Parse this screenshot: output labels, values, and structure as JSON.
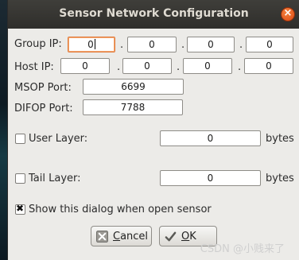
{
  "dialog": {
    "title": "Sensor Network Configuration"
  },
  "group_ip": {
    "label": "Group IP:",
    "octets": [
      "0",
      "0",
      "0",
      "0"
    ],
    "separator": "."
  },
  "host_ip": {
    "label": "Host  IP:",
    "octets": [
      "0",
      "0",
      "0",
      "0"
    ],
    "separator": "."
  },
  "msop": {
    "label": "MSOP  Port:",
    "value": "6699"
  },
  "difop": {
    "label": "DIFOP Port:",
    "value": "7788"
  },
  "user_layer": {
    "label": "User Layer:",
    "value": "0",
    "unit": "bytes",
    "checked": false
  },
  "tail_layer": {
    "label": "Tail Layer:",
    "value": "0",
    "unit": "bytes",
    "checked": false
  },
  "show_dialog": {
    "label": "Show this dialog when open sensor",
    "checked": true
  },
  "buttons": {
    "cancel_first": "C",
    "cancel_rest": "ancel",
    "ok_first": "O",
    "ok_rest": "K"
  },
  "watermark": "CSDN @小贱来了",
  "icons": {
    "close": "close-icon",
    "cancel": "cancel-x-icon",
    "ok": "check-icon"
  }
}
